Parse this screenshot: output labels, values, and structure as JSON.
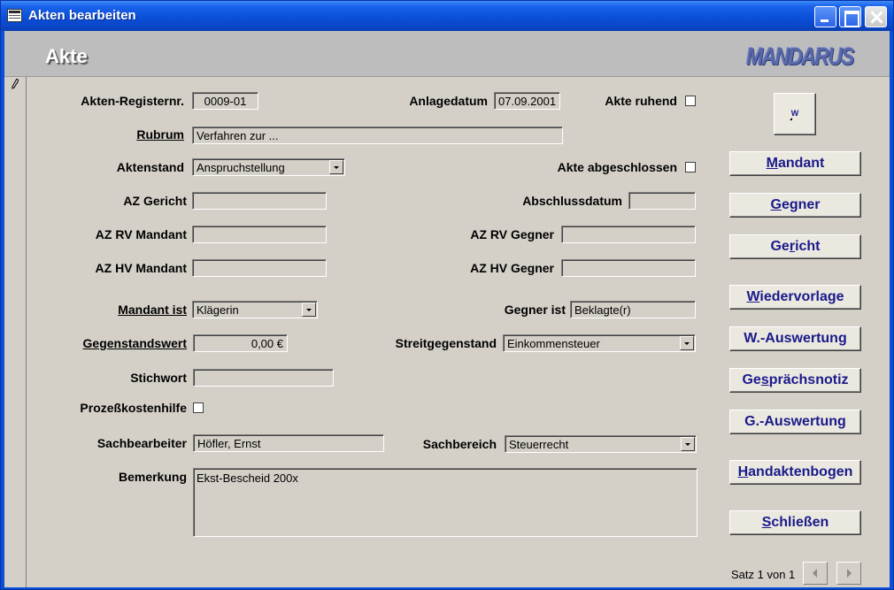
{
  "window": {
    "title": "Akten bearbeiten"
  },
  "header": {
    "title": "Akte",
    "logo": "MANDARUS"
  },
  "form": {
    "aktenregister": {
      "label": "Akten-Registernr.",
      "value": "0009-01"
    },
    "anlagedatum": {
      "label": "Anlagedatum",
      "value": "07.09.2001"
    },
    "akte_ruhend": {
      "label": "Akte ruhend",
      "checked": false
    },
    "rubrum": {
      "label": "Rubrum",
      "value": "Verfahren zur ..."
    },
    "aktenstand": {
      "label": "Aktenstand",
      "value": "Anspruchstellung"
    },
    "akte_abgeschlossen": {
      "label": "Akte abgeschlossen",
      "checked": false
    },
    "az_gericht": {
      "label": "AZ Gericht",
      "value": ""
    },
    "abschlussdatum": {
      "label": "Abschlussdatum",
      "value": ""
    },
    "az_rv_mandant": {
      "label": "AZ RV Mandant",
      "value": ""
    },
    "az_rv_gegner": {
      "label": "AZ RV Gegner",
      "value": ""
    },
    "az_hv_mandant": {
      "label": "AZ HV Mandant",
      "value": ""
    },
    "az_hv_gegner": {
      "label": "AZ HV Gegner",
      "value": ""
    },
    "mandant_ist": {
      "label": "Mandant ist",
      "value": "Klägerin"
    },
    "gegner_ist": {
      "label": "Gegner ist",
      "value": "Beklagte(r)"
    },
    "gegenstandswert": {
      "label": "Gegenstandswert",
      "value": "0,00 €"
    },
    "streitgegenstand": {
      "label": "Streitgegenstand",
      "value": "Einkommensteuer"
    },
    "stichwort": {
      "label": "Stichwort",
      "value": ""
    },
    "prozesskostenhilfe": {
      "label": "Prozeßkostenhilfe",
      "checked": false
    },
    "sachbearbeiter": {
      "label": "Sachbearbeiter",
      "value": "Höfler, Ernst"
    },
    "sachbereich": {
      "label": "Sachbereich",
      "value": "Steuerrecht"
    },
    "bemerkung": {
      "label": "Bemerkung",
      "value": "Ekst-Bescheid 200x"
    }
  },
  "buttons": {
    "word": "W",
    "mandant": {
      "pre": "",
      "acc": "M",
      "post": "andant"
    },
    "gegner": {
      "pre": "",
      "acc": "G",
      "post": "egner"
    },
    "gericht": {
      "pre": "Ge",
      "acc": "r",
      "post": "icht"
    },
    "wiedervorlage": {
      "pre": "",
      "acc": "W",
      "post": "iedervorlage"
    },
    "w_auswertung": {
      "pre": "W.-Auswertung",
      "acc": "",
      "post": ""
    },
    "gespraechsnotiz": {
      "pre": "Ge",
      "acc": "s",
      "post": "prächsnotiz"
    },
    "g_auswertung": {
      "pre": "G.-Auswertung",
      "acc": "",
      "post": ""
    },
    "handaktenbogen": {
      "pre": "",
      "acc": "H",
      "post": "andaktenbogen"
    },
    "schliessen": {
      "pre": "",
      "acc": "S",
      "post": "chließen"
    }
  },
  "navigation": {
    "record_text": "Satz 1 von 1"
  }
}
